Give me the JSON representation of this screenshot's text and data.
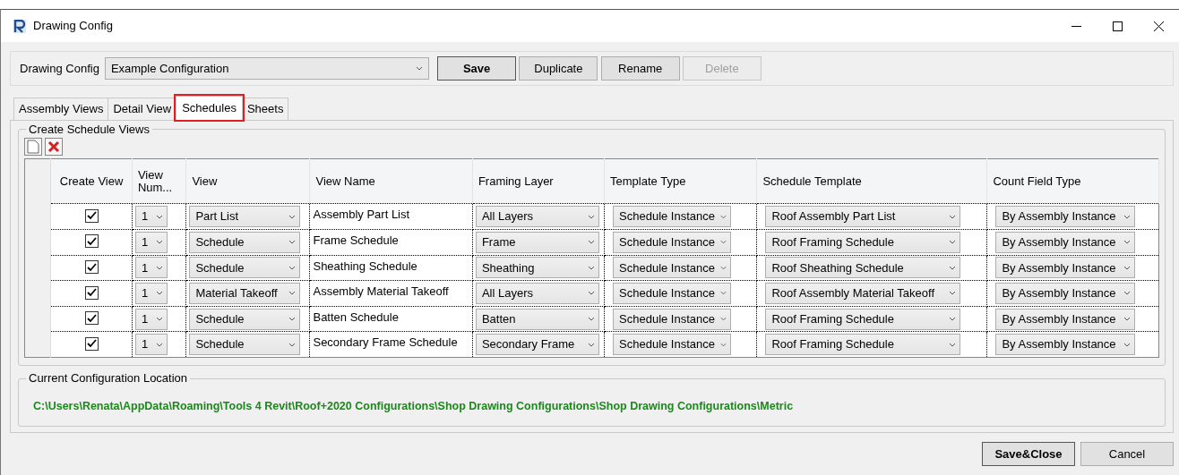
{
  "window": {
    "title": "Drawing Config"
  },
  "config": {
    "label": "Drawing Config",
    "value": "Example Configuration"
  },
  "buttons": [
    {
      "label": "Save",
      "default": true,
      "disabled": false
    },
    {
      "label": "Duplicate",
      "default": false,
      "disabled": false
    },
    {
      "label": "Rename",
      "default": false,
      "disabled": false
    },
    {
      "label": "Delete",
      "default": false,
      "disabled": true
    }
  ],
  "tabs": [
    {
      "label": "Assembly Views",
      "selected": false
    },
    {
      "label": "Detail View",
      "selected": false
    },
    {
      "label": "Schedules",
      "selected": true
    },
    {
      "label": "Sheets",
      "selected": false
    }
  ],
  "group": {
    "title": "Create Schedule Views"
  },
  "table": {
    "columns": [
      "Create View",
      "View Num...",
      "View",
      "View Name",
      "Framing Layer",
      "Template Type",
      "Schedule Template",
      "Count Field Type"
    ],
    "rows": [
      {
        "checked": true,
        "view_number": "1",
        "view": "Part List",
        "view_name": "Assembly Part List",
        "framing_layer": "All Layers",
        "template_type": "Schedule Instance",
        "schedule_template": "Roof Assembly Part List",
        "count_field_type": "By Assembly Instance"
      },
      {
        "checked": true,
        "view_number": "1",
        "view": "Schedule",
        "view_name": "Frame Schedule",
        "framing_layer": "Frame",
        "template_type": "Schedule Instance",
        "schedule_template": "Roof Framing Schedule",
        "count_field_type": "By Assembly Instance"
      },
      {
        "checked": true,
        "view_number": "1",
        "view": "Schedule",
        "view_name": "Sheathing Schedule",
        "framing_layer": "Sheathing",
        "template_type": "Schedule Instance",
        "schedule_template": "Roof Sheathing Schedule",
        "count_field_type": "By Assembly Instance"
      },
      {
        "checked": true,
        "view_number": "1",
        "view": "Material Takeoff",
        "view_name": "Assembly Material Takeoff",
        "framing_layer": "All Layers",
        "template_type": "Schedule Instance",
        "schedule_template": "Roof Assembly Material Takeoff",
        "count_field_type": "By Assembly Instance"
      },
      {
        "checked": true,
        "view_number": "1",
        "view": "Schedule",
        "view_name": "Batten Schedule",
        "framing_layer": "Batten",
        "template_type": "Schedule Instance",
        "schedule_template": "Roof Framing Schedule",
        "count_field_type": "By Assembly Instance"
      },
      {
        "checked": true,
        "view_number": "1",
        "view": "Schedule",
        "view_name": "Secondary Frame Schedule",
        "framing_layer": "Secondary Frame",
        "template_type": "Schedule Instance",
        "schedule_template": "Roof Framing Schedule",
        "count_field_type": "By Assembly Instance"
      }
    ]
  },
  "location": {
    "title": "Current Configuration Location",
    "path": "C:\\Users\\Renata\\AppData\\Roaming\\Tools 4 Revit\\Roof+2020 Configurations\\Shop Drawing Configurations\\Shop Drawing Configurations\\Metric"
  },
  "footer_buttons": [
    {
      "label": "Save&Close",
      "default": true
    },
    {
      "label": "Cancel",
      "default": false
    }
  ]
}
